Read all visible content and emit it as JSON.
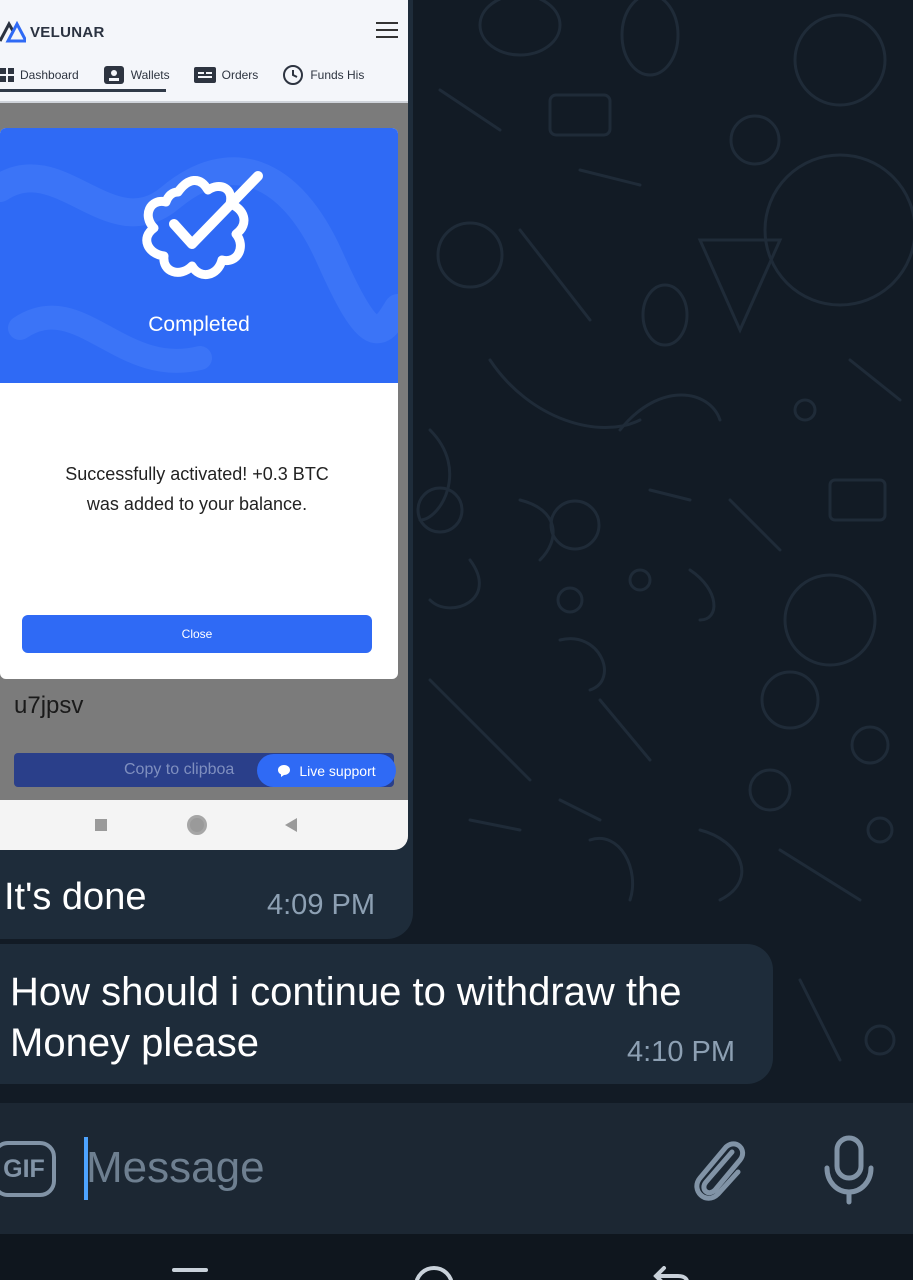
{
  "app": {
    "brand": "VELUNAR",
    "nav": [
      {
        "label": "Dashboard",
        "icon": "dashboard-icon"
      },
      {
        "label": "Wallets",
        "icon": "wallet-icon"
      },
      {
        "label": "Orders",
        "icon": "orders-icon"
      },
      {
        "label": "Funds His",
        "icon": "history-icon"
      }
    ],
    "modal": {
      "title": "Completed",
      "message": "Successfully activated! +0.3 BTC was added to your balance.",
      "close_label": "Close",
      "icon": "verified-badge-icon"
    },
    "code": "u7jpsv",
    "copy_label": "Copy to clipboa",
    "live_support_label": "Live support"
  },
  "messages": [
    {
      "text": "It's done",
      "time": "4:09 PM"
    },
    {
      "text": "How should i continue to withdraw the Money please",
      "time": "4:10 PM"
    }
  ],
  "composer": {
    "gif_label": "GIF",
    "placeholder": "Message",
    "attach_icon": "paperclip-icon",
    "mic_icon": "microphone-icon"
  },
  "colors": {
    "chat_background": "#121b25",
    "bubble": "#1e2c3a",
    "accent_blue": "#2f6af5",
    "timestamp": "#8da0b3"
  }
}
